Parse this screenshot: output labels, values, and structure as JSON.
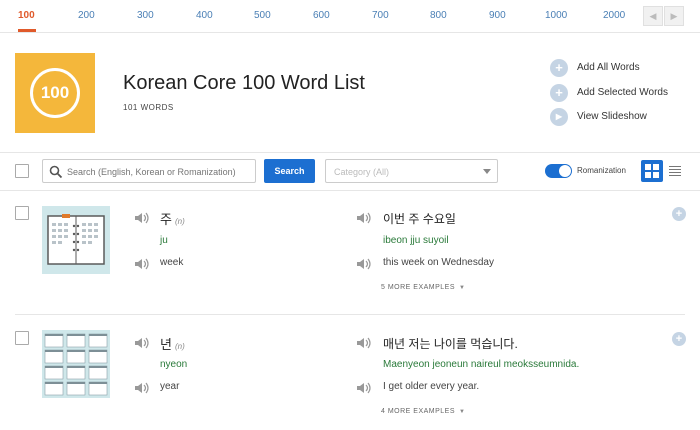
{
  "nav": {
    "tabs": [
      "100",
      "200",
      "300",
      "400",
      "500",
      "600",
      "700",
      "800",
      "900",
      "1000",
      "2000"
    ],
    "active": "100",
    "prev_icon": "chevron-left-icon",
    "next_icon": "chevron-right-icon"
  },
  "header": {
    "badge_text": "100",
    "title": "Korean Core 100 Word List",
    "count": "101 WORDS",
    "actions": [
      {
        "label": "Add All Words",
        "icon": "plus-icon"
      },
      {
        "label": "Add Selected Words",
        "icon": "plus-icon"
      },
      {
        "label": "View Slideshow",
        "icon": "play-icon"
      }
    ]
  },
  "toolbar": {
    "search_placeholder": "Search (English, Korean or Romanization)",
    "search_button": "Search",
    "category_value": "Category (All)",
    "romanization_label": "Romanization",
    "romanization_on": true
  },
  "entries": [
    {
      "word": "주",
      "pos": "(n)",
      "romanization": "ju",
      "english": "week",
      "example_korean": "이번 주 수요일",
      "example_romanization": "ibeon jju suyoil",
      "example_english": "this week on Wednesday",
      "more_examples": "5 MORE EXAMPLES"
    },
    {
      "word": "년",
      "pos": "(n)",
      "romanization": "nyeon",
      "english": "year",
      "example_korean": "매년 저는 나이를 먹습니다.",
      "example_romanization": "Maenyeon jeoneun naireul meoksseumnida.",
      "example_english": "I get older every year.",
      "more_examples": "4 MORE EXAMPLES"
    }
  ],
  "colors": {
    "accent": "#1c6fd1",
    "active_tab": "#e05a2b",
    "badge": "#f4b73b",
    "romanization": "#2a7a3a"
  }
}
